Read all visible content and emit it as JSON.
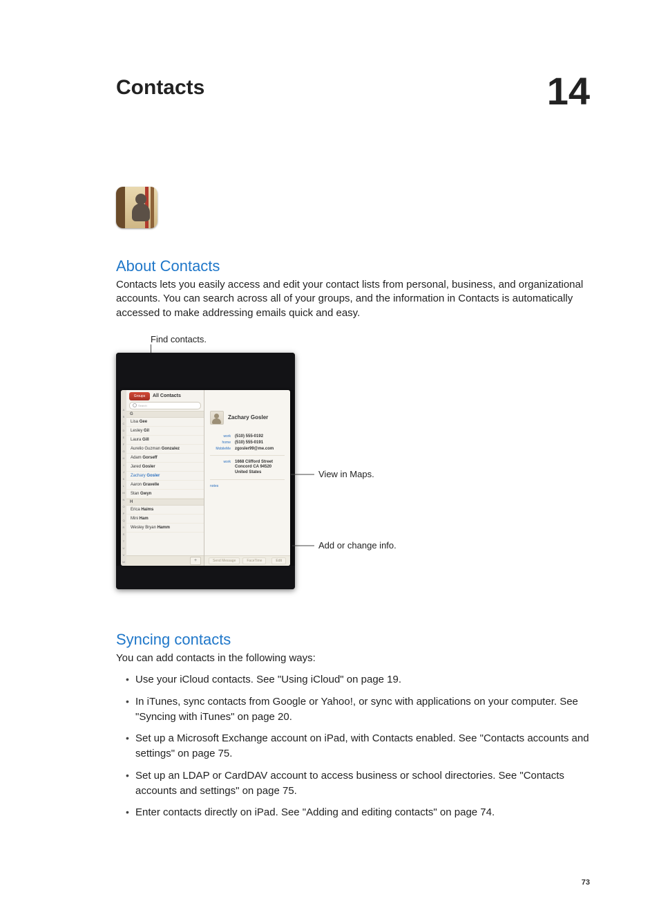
{
  "chapter": {
    "title": "Contacts",
    "number": "14"
  },
  "section_about": {
    "heading": "About Contacts",
    "body": "Contacts lets you easily access and edit your contact lists from personal, business, and organizational accounts. You can search across all of your groups, and the information in Contacts is automatically accessed to make addressing emails quick and easy."
  },
  "diagram": {
    "find_label": "Find contacts.",
    "view_maps": "View in Maps.",
    "add_change": "Add or change info.",
    "left": {
      "groups": "Groups",
      "all_contacts": "All Contacts",
      "search_placeholder": "Search",
      "index_letters": [
        "A",
        "B",
        "C",
        "D",
        "E",
        "F",
        "G",
        "H",
        "I",
        "J",
        "K",
        "L",
        "M",
        "N",
        "O",
        "P",
        "Q",
        "R",
        "S",
        "T",
        "U",
        "V",
        "W",
        "X",
        "Y",
        "Z",
        "#"
      ],
      "sections": [
        {
          "letter": "G",
          "items": [
            {
              "first": "Lisa",
              "last": "Gee"
            },
            {
              "first": "Lesley",
              "last": "Gil"
            },
            {
              "first": "Laura",
              "last": "Gill"
            },
            {
              "first": "Aurelio Guzman",
              "last": "Gonzalez"
            },
            {
              "first": "Adam",
              "last": "Gorseff"
            },
            {
              "first": "Jared",
              "last": "Gosler"
            },
            {
              "first": "Zachary",
              "last": "Gosler",
              "selected": true
            },
            {
              "first": "Aaron",
              "last": "Gravelle"
            },
            {
              "first": "Stan",
              "last": "Gwyn"
            }
          ]
        },
        {
          "letter": "H",
          "items": [
            {
              "first": "Erica",
              "last": "Haims"
            },
            {
              "first": "Mini",
              "last": "Ham"
            },
            {
              "first": "Wesley Bryan",
              "last": "Hamm"
            }
          ]
        }
      ],
      "plus": "+"
    },
    "card": {
      "name": "Zachary Gosler",
      "fields": [
        {
          "lbl": "work",
          "val": "(510) 555-0192"
        },
        {
          "lbl": "home",
          "val": "(510) 555-0191"
        },
        {
          "lbl": "MobileMe",
          "val": "zgosler99@me.com"
        }
      ],
      "address": {
        "lbl": "work",
        "lines": [
          "1668 Clifford Street",
          "Concord CA 94520",
          "United States"
        ]
      },
      "notes_lbl": "notes",
      "footer": {
        "left": "Send Message",
        "right": "FaceTime",
        "edit": "Edit"
      }
    }
  },
  "section_sync": {
    "heading": "Syncing contacts",
    "intro": "You can add contacts in the following ways:",
    "bullets": [
      "Use your iCloud contacts. See \"Using iCloud\" on page 19.",
      "In iTunes, sync contacts from Google or Yahoo!, or sync with applications on your computer. See \"Syncing with iTunes\" on page 20.",
      "Set up a Microsoft Exchange account on iPad, with Contacts enabled. See \"Contacts accounts and settings\" on page 75.",
      "Set up an LDAP or CardDAV account to access business or school directories. See \"Contacts accounts and settings\" on page 75.",
      "Enter contacts directly on iPad. See \"Adding and editing contacts\" on page 74."
    ]
  },
  "page_number": "73"
}
